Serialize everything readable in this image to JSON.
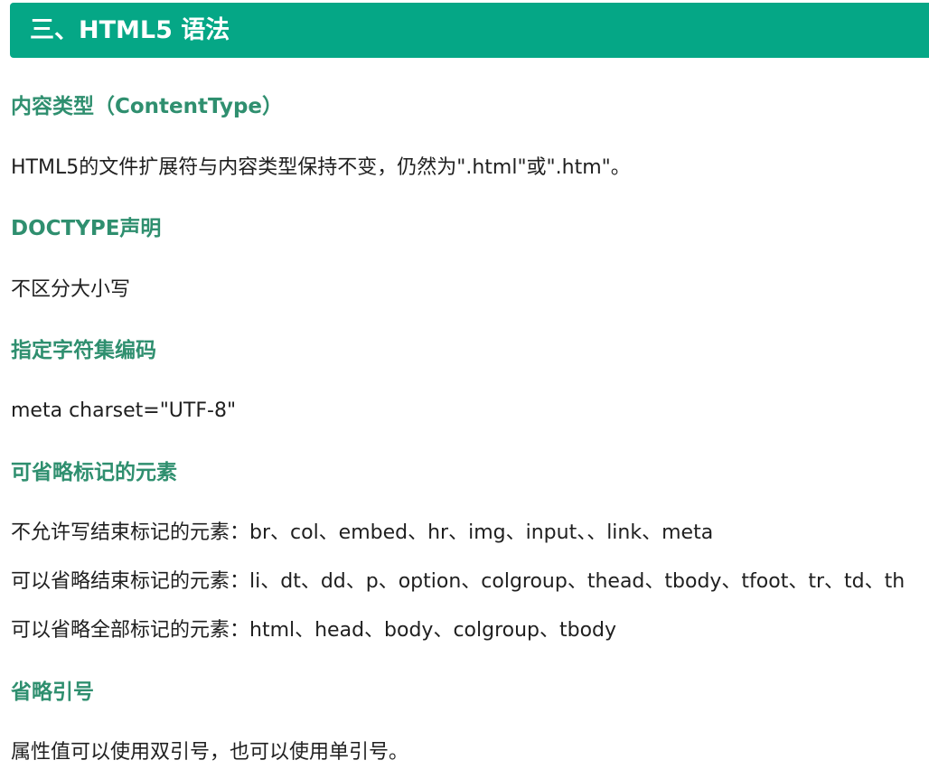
{
  "section": {
    "title": "三、HTML5 语法"
  },
  "content": {
    "content_type": {
      "heading": "内容类型（ContentType）",
      "text": "HTML5的文件扩展符与内容类型保持不变，仍然为\".html\"或\".htm\"。"
    },
    "doctype": {
      "heading": "DOCTYPE声明",
      "text": "不区分大小写"
    },
    "charset": {
      "heading": "指定字符集编码",
      "text": "meta charset=\"UTF-8\""
    },
    "omittable": {
      "heading": "可省略标记的元素",
      "lines": [
        "不允许写结束标记的元素：br、col、embed、hr、img、input、、link、meta",
        "可以省略结束标记的元素：li、dt、dd、p、option、colgroup、thead、tbody、tfoot、tr、td、th",
        "可以省略全部标记的元素：html、head、body、colgroup、tbody"
      ]
    },
    "quotes": {
      "heading": "省略引号",
      "text": "属性值可以使用双引号，也可以使用单引号。"
    }
  },
  "colors": {
    "banner": "#05a786",
    "heading": "#2f8f6f",
    "body_text": "#1f1f1f"
  }
}
